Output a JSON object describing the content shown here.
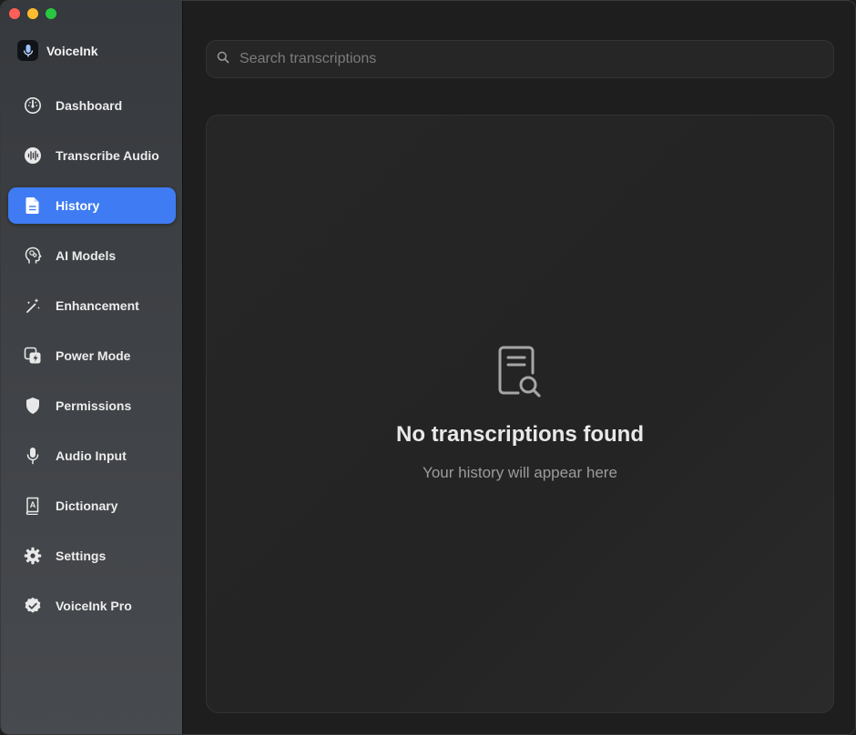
{
  "app": {
    "name": "VoiceInk"
  },
  "sidebar": {
    "items": [
      {
        "label": "Dashboard",
        "icon": "gauge-icon"
      },
      {
        "label": "Transcribe Audio",
        "icon": "waveform-icon"
      },
      {
        "label": "History",
        "icon": "document-icon",
        "active": true
      },
      {
        "label": "AI Models",
        "icon": "brain-head-icon"
      },
      {
        "label": "Enhancement",
        "icon": "magic-wand-icon"
      },
      {
        "label": "Power Mode",
        "icon": "power-mode-icon"
      },
      {
        "label": "Permissions",
        "icon": "shield-icon"
      },
      {
        "label": "Audio Input",
        "icon": "microphone-icon"
      },
      {
        "label": "Dictionary",
        "icon": "dictionary-icon"
      },
      {
        "label": "Settings",
        "icon": "gear-icon"
      },
      {
        "label": "VoiceInk Pro",
        "icon": "verified-badge-icon"
      }
    ]
  },
  "search": {
    "placeholder": "Search transcriptions",
    "value": ""
  },
  "empty_state": {
    "title": "No transcriptions found",
    "subtitle": "Your history will appear here",
    "icon": "document-search-icon"
  },
  "colors": {
    "accent": "#3f7cf3",
    "sidebar_bg": "#3c3f43",
    "main_bg": "#1e1e1e",
    "panel_bg": "#252525"
  }
}
